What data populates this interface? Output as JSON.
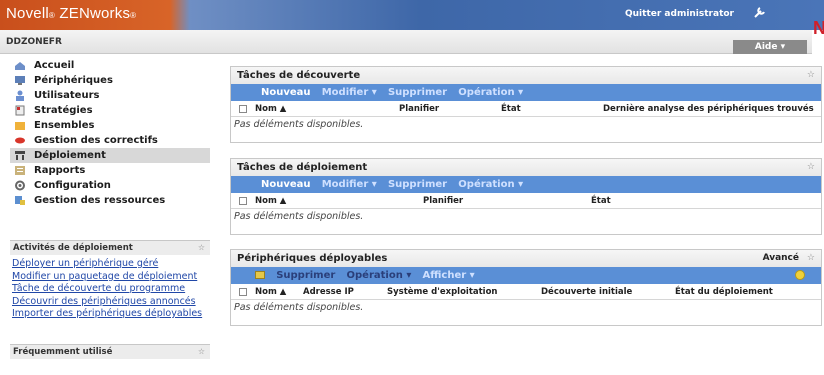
{
  "header": {
    "brand": "Novell",
    "brand_suffix": "ZENworks",
    "quit_label": "Quitter administrator",
    "zone": "DDZONEFR",
    "help_label": "Aide ▾",
    "novell_mark": "N"
  },
  "nav": {
    "items": [
      {
        "label": "Accueil"
      },
      {
        "label": "Périphériques"
      },
      {
        "label": "Utilisateurs"
      },
      {
        "label": "Stratégies"
      },
      {
        "label": "Ensembles"
      },
      {
        "label": "Gestion des correctifs"
      },
      {
        "label": "Déploiement"
      },
      {
        "label": "Rapports"
      },
      {
        "label": "Configuration"
      },
      {
        "label": "Gestion des ressources"
      }
    ],
    "activities_title": "Activités de déploiement",
    "activities_links": [
      "Déployer un périphérique géré",
      "Modifier un paquetage de déploiement",
      "Tâche de découverte du programme",
      "Découvrir des périphériques annoncés",
      "Importer des périphériques déployables"
    ],
    "frequent_title": "Fréquemment utilisé"
  },
  "discovery": {
    "title": "Tâches de découverte",
    "toolbar": [
      "Nouveau",
      "Modifier ▾",
      "Supprimer",
      "Opération ▾"
    ],
    "columns": [
      "Nom ▲",
      "Planifier",
      "État",
      "Dernière analyse des périphériques trouvés"
    ],
    "empty": "Pas déléments disponibles."
  },
  "deployment": {
    "title": "Tâches de déploiement",
    "toolbar": [
      "Nouveau",
      "Modifier ▾",
      "Supprimer",
      "Opération ▾"
    ],
    "columns": [
      "Nom ▲",
      "Planifier",
      "État"
    ],
    "empty": "Pas déléments disponibles."
  },
  "deployable": {
    "title": "Périphériques déployables",
    "advanced": "Avancé",
    "toolbar": [
      "Supprimer",
      "Opération ▾",
      "Afficher ▾"
    ],
    "columns": [
      "Nom ▲",
      "Adresse IP",
      "Système d'exploitation",
      "Découverte initiale",
      "État du déploiement"
    ],
    "empty": "Pas déléments disponibles."
  }
}
